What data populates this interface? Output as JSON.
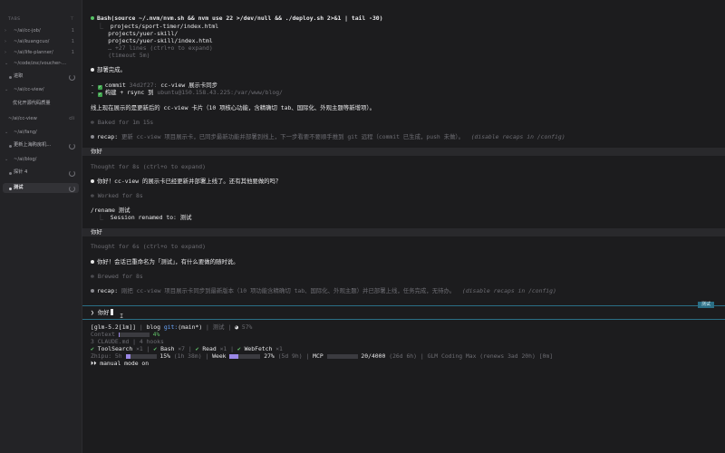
{
  "sidebar": {
    "header_label": "TABS",
    "header_action": "⊤",
    "items": [
      {
        "type": "group",
        "label": "~/ai/cc-job/",
        "count": "1"
      },
      {
        "type": "group",
        "label": "~/ai/kuangcuo/",
        "count": "1"
      },
      {
        "type": "group",
        "label": "~/ai/life-planner/",
        "count": "1"
      },
      {
        "type": "group",
        "label": "~/code/zsc/voucher-eng..."
      },
      {
        "type": "session",
        "label": "进职"
      },
      {
        "type": "group",
        "label": "~/ai/cc-view/"
      },
      {
        "type": "session",
        "label": "优化开源代码质量"
      },
      {
        "type": "plain",
        "label": "~/ai/cc-view",
        "count": "cli"
      },
      {
        "type": "group",
        "label": "~/ai/fang/"
      },
      {
        "type": "session",
        "label": "更新上海购房机..."
      },
      {
        "type": "group",
        "label": "~/ai/blog/"
      },
      {
        "type": "session",
        "label": "探针 4"
      },
      {
        "type": "session",
        "label": "测试",
        "active": true
      }
    ]
  },
  "transcript": {
    "bash_cmd": "Bash(source ~/.nvm/nvm.sh && nvm use 22 >/dev/null && ./deploy.sh 2>&1 | tail -30)",
    "bash_out1": "projects/sport-timer/index.html",
    "bash_out2": "projects/yuer-skill/",
    "bash_out3": "projects/yuer-skill/index.html",
    "bash_more": "… +27 lines (ctrl+o to expand)",
    "bash_timeout": "(timeout 5m)",
    "deploy_done": "部署完成。",
    "commit_label": "commit",
    "commit_hash": "34d2f27:",
    "commit_msg": "cc-view 展示卡同步",
    "build_label": "构建 + rsync 到",
    "build_target": "ubuntu@150.158.43.225:/var/www/blog/",
    "online_text": "线上现在展示的是更新后的 cc-view 卡片（10 项核心功能，含精确切 tab、国际化、外观主题等新增项）。",
    "baked": "Baked for 1m 15s",
    "recap1_label": "recap:",
    "recap1_text": "更新 cc-view 项目展示卡，已同步最新功能并部署到线上，下一步看要不要顺手推到 git 远程（commit 已生成，push 未做）。",
    "recap1_hint": "(disable recaps in /config)",
    "user_msg1": "你好",
    "thought1": "Thought for 8s (ctrl+o to expand)",
    "reply1": "你好！cc-view 的展示卡已经更新并部署上线了。还有其他要做的吗？",
    "worked": "Worked for 8s",
    "rename_cmd": "/rename 测试",
    "rename_out": "Session renamed to: 测试",
    "user_msg2": "你好",
    "thought2": "Thought for 6s (ctrl+o to expand)",
    "reply2": "你好！会话已重命名为「测试」，有什么要做的随时说。",
    "brewed": "Brewed for 8s",
    "recap2_label": "recap:",
    "recap2_text": "刚把 cc-view 项目展示卡同步到最新版本（10 项功能含精确切 tab、国际化、外观主题）并已部署上线，任务完成，无待办。",
    "recap2_hint": "(disable recaps in /config)"
  },
  "session_tag": "测试",
  "prompt": {
    "symbol": "❯",
    "input_value": "你好"
  },
  "status": {
    "model": "[glm-5.2[1m]]",
    "project": "blog",
    "git_label": "git:",
    "branch": "(main*)",
    "session_name": "测试",
    "pct_right": "57%",
    "context_label": "Context",
    "context_pct": "4%",
    "context_fill": 0.04,
    "mcp_line": "3 CLAUDE.md | 4 hooks",
    "tools_line_1": "ToolSearch",
    "tools_line_1b": "×1",
    "tools_line_2": "Bash",
    "tools_line_2b": "×7",
    "tools_line_3": "Read",
    "tools_line_3b": "×1",
    "tools_line_4": "WebFetch",
    "tools_line_4b": "×1",
    "usage_label": "Zhipu: 5h",
    "usage_5h_pct": "15%",
    "usage_5h_fill": 0.15,
    "usage_5h_reset": "(1h 38m)",
    "usage_week_label": "Week",
    "usage_week_pct": "27%",
    "usage_week_fill": 0.27,
    "usage_week_reset": "(5d 9h)",
    "usage_mcp_label": "MCP",
    "usage_mcp_value": "20/4000",
    "usage_mcp_reset": "(26d 6h)",
    "plan_text": "GLM Coding Max (renews 3ad 20h) [0m]",
    "mode_text": "⏵⏵ manual mode on"
  }
}
